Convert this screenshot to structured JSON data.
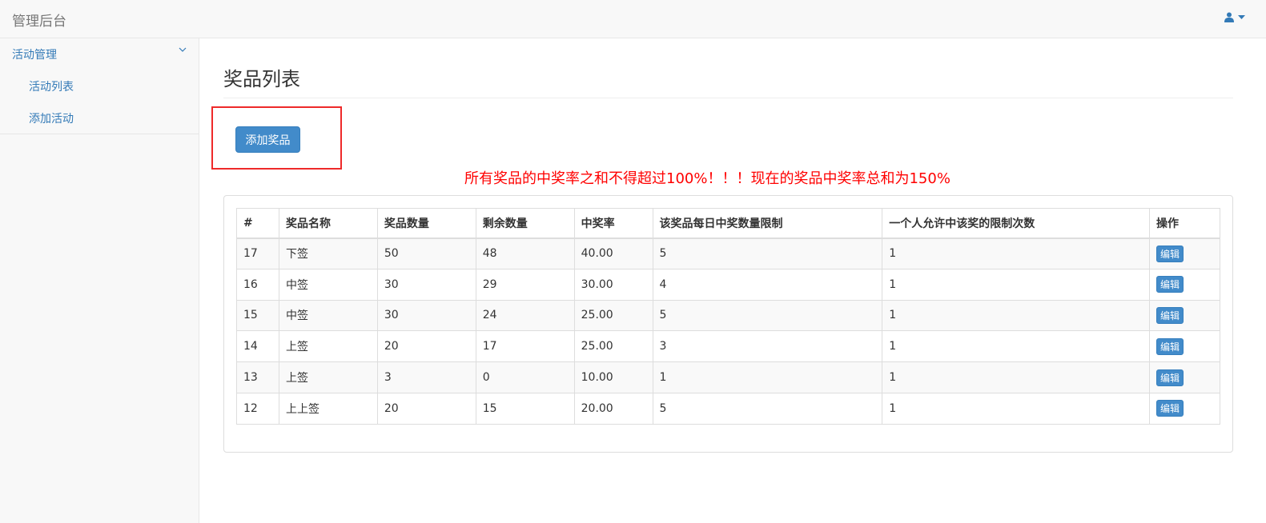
{
  "navbar": {
    "brand": "管理后台"
  },
  "sidebar": {
    "group_label": "活动管理",
    "items": [
      {
        "label": "活动列表"
      },
      {
        "label": "添加活动"
      }
    ]
  },
  "main": {
    "title": "奖品列表",
    "add_button": "添加奖品",
    "warning": "所有奖品的中奖率之和不得超过100%！！！现在的奖品中奖率总和为150%"
  },
  "table": {
    "headers": [
      "#",
      "奖品名称",
      "奖品数量",
      "剩余数量",
      "中奖率",
      "该奖品每日中奖数量限制",
      "一个人允许中该奖的限制次数",
      "操作"
    ],
    "edit_label": "编辑",
    "rows": [
      {
        "id": "17",
        "name": "下签",
        "qty": "50",
        "remain": "48",
        "rate": "40.00",
        "daily": "5",
        "per_person": "1"
      },
      {
        "id": "16",
        "name": "中签",
        "qty": "30",
        "remain": "29",
        "rate": "30.00",
        "daily": "4",
        "per_person": "1"
      },
      {
        "id": "15",
        "name": "中签",
        "qty": "30",
        "remain": "24",
        "rate": "25.00",
        "daily": "5",
        "per_person": "1"
      },
      {
        "id": "14",
        "name": "上签",
        "qty": "20",
        "remain": "17",
        "rate": "25.00",
        "daily": "3",
        "per_person": "1"
      },
      {
        "id": "13",
        "name": "上签",
        "qty": "3",
        "remain": "0",
        "rate": "10.00",
        "daily": "1",
        "per_person": "1"
      },
      {
        "id": "12",
        "name": "上上签",
        "qty": "20",
        "remain": "15",
        "rate": "20.00",
        "daily": "5",
        "per_person": "1"
      }
    ]
  },
  "colors": {
    "accent": "#428bca",
    "link": "#337ab7",
    "warning": "#ff0000",
    "highlight": "#ee2a2a"
  }
}
